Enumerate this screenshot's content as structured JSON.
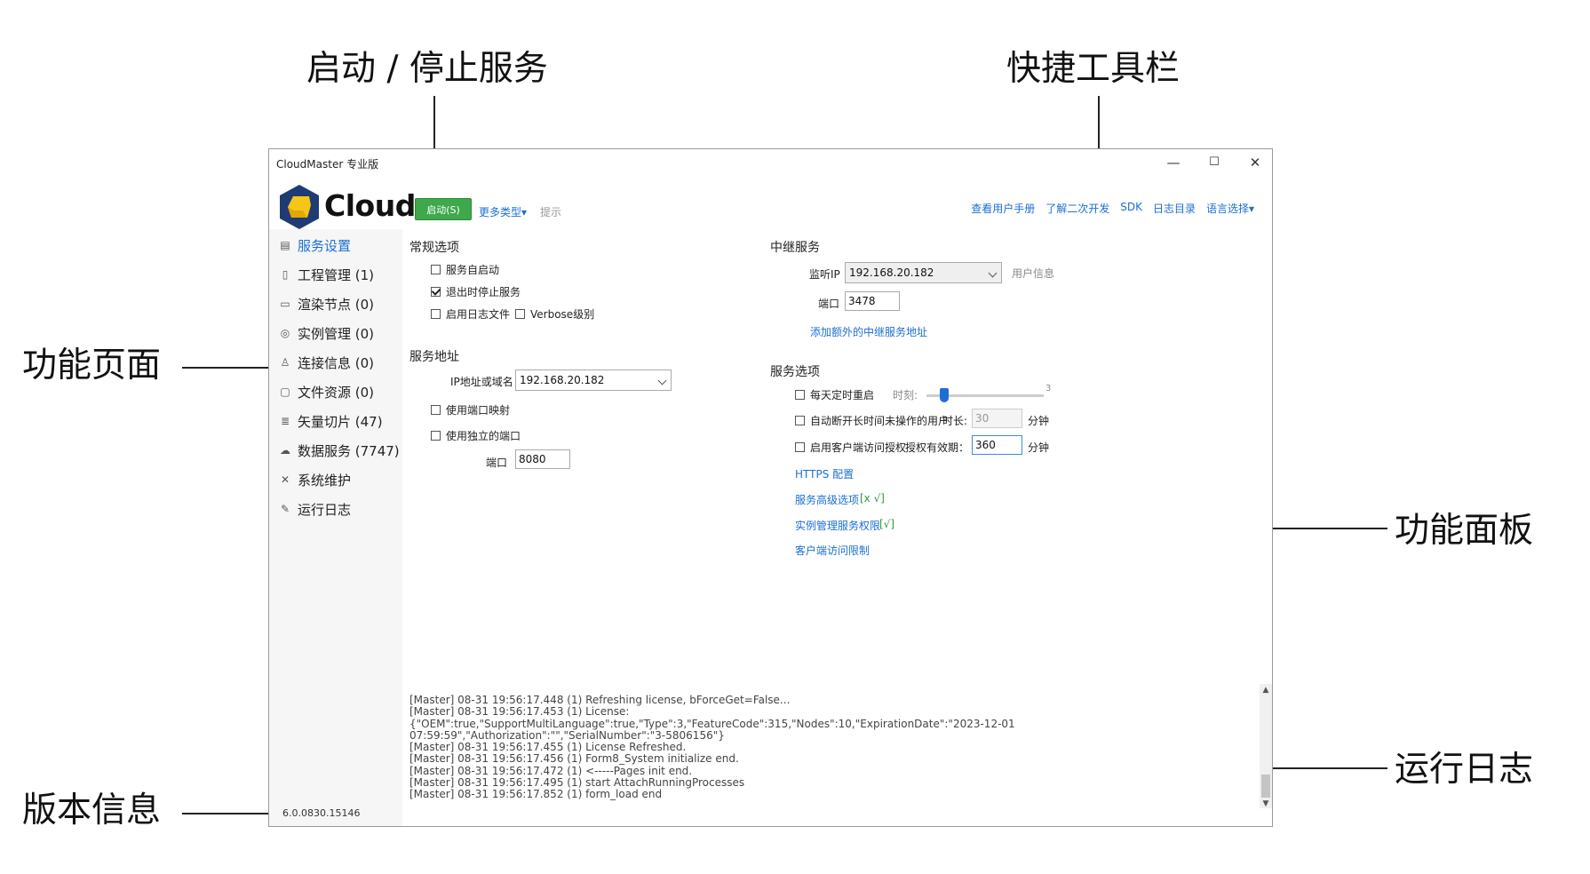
{
  "callouts": {
    "start_stop": "启动 / 停止服务",
    "quick_toolbar": "快捷工具栏",
    "function_pages": "功能页面",
    "function_panel": "功能面板",
    "run_log": "运行日志",
    "version_info": "版本信息"
  },
  "window": {
    "title": "CloudMaster 专业版",
    "controls": {
      "minimize": "—",
      "maximize": "☐",
      "close": "✕"
    }
  },
  "toolbar": {
    "brand": "Cloud",
    "start_label": "启动(S)",
    "more_types": "更多类型▾",
    "hint": "提示",
    "quick_links": [
      "查看用户手册",
      "了解二次开发",
      "SDK",
      "日志目录",
      "语言选择▾"
    ]
  },
  "sidebar": {
    "items": [
      {
        "label": "服务设置",
        "icon": "settings-doc-icon"
      },
      {
        "label": "工程管理 (1)",
        "icon": "document-icon"
      },
      {
        "label": "渲染节点 (0)",
        "icon": "monitor-icon"
      },
      {
        "label": "实例管理 (0)",
        "icon": "instance-circle-icon"
      },
      {
        "label": "连接信息 (0)",
        "icon": "user-icon"
      },
      {
        "label": "文件资源 (0)",
        "icon": "file-icon"
      },
      {
        "label": "矢量切片 (47)",
        "icon": "database-icon"
      },
      {
        "label": "数据服务 (7747)",
        "icon": "cloud-service-icon"
      },
      {
        "label": "系统维护",
        "icon": "tools-icon"
      },
      {
        "label": "运行日志",
        "icon": "log-edit-icon"
      }
    ],
    "version": "6.0.0830.15146"
  },
  "general": {
    "title": "常规选项",
    "auto_start": "服务自启动",
    "stop_on_exit": "退出时停止服务",
    "enable_log_file": "启用日志文件",
    "verbose": "Verbose级别"
  },
  "address": {
    "title": "服务地址",
    "ip_label": "IP地址或域名",
    "ip_value": "192.168.20.182",
    "port_mapping": "使用端口映射",
    "independent_port": "使用独立的端口",
    "port_label": "端口",
    "port_value": "8080"
  },
  "relay": {
    "title": "中继服务",
    "listen_ip_label": "监听IP",
    "listen_ip_value": "192.168.20.182",
    "user_info": "用户信息",
    "port_label": "端口",
    "port_value": "3478",
    "add_relay_link": "添加额外的中继服务地址"
  },
  "service_options": {
    "title": "服务选项",
    "daily_restart": "每天定时重启",
    "time_label": "时刻:",
    "slider_max": "3",
    "disconnect_idle": "自动断开长时间未操作的用户",
    "duration_label": "时长:",
    "duration_value": "30",
    "minutes": "分钟",
    "client_auth": "启用客户端访问授权",
    "validity_label": "授权有效期：",
    "validity_value": "360",
    "https_link": "HTTPS 配置",
    "advanced_link": "服务高级选项",
    "advanced_tag": "[x √]",
    "instance_perm_link": "实例管理服务权限",
    "instance_perm_tag": "[√]",
    "client_limit_link": "客户端访问限制"
  },
  "log": {
    "lines": [
      "[Master] 08-31 19:56:17.448 (1) Refreshing license, bForceGet=False...",
      "[Master] 08-31 19:56:17.453 (1) License:",
      "{\"OEM\":true,\"SupportMultiLanguage\":true,\"Type\":3,\"FeatureCode\":315,\"Nodes\":10,\"ExpirationDate\":\"2023-12-01",
      "07:59:59\",\"Authorization\":\"\",\"SerialNumber\":\"3-5806156\"}",
      "[Master] 08-31 19:56:17.455 (1) License Refreshed.",
      "[Master] 08-31 19:56:17.456 (1) Form8_System initialize end.",
      "[Master] 08-31 19:56:17.472 (1) <-----Pages init end.",
      "[Master] 08-31 19:56:17.495 (1) start AttachRunningProcesses",
      "[Master] 08-31 19:56:17.852 (1) form_load end"
    ]
  },
  "colors": {
    "accent": "#1c6fd1",
    "start_green": "#3ea84b",
    "logo_navy": "#1f3b73",
    "logo_yellow": "#f5c518"
  }
}
